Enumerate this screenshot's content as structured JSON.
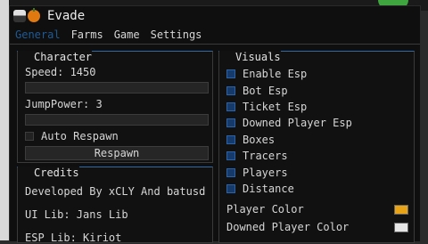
{
  "window": {
    "title": "Evade"
  },
  "menu": {
    "tabs": [
      "General",
      "Farms",
      "Game",
      "Settings"
    ],
    "active": "General"
  },
  "character": {
    "title": "Character",
    "speed_label": "Speed: 1450",
    "speed_value": 1450,
    "jump_label": "JumpPower: 3",
    "jump_value": 3,
    "auto_respawn_label": "Auto Respawn",
    "respawn_button": "Respawn"
  },
  "credits": {
    "title": "Credits",
    "lines": [
      "Developed By xCLY And batusd",
      "UI Lib: Jans Lib",
      "ESP Lib: Kiriot"
    ]
  },
  "visuals": {
    "title": "Visuals",
    "items": [
      "Enable Esp",
      "Bot Esp",
      "Ticket Esp",
      "Downed Player Esp",
      "Boxes",
      "Tracers",
      "Players",
      "Distance"
    ],
    "player_color_label": "Player Color",
    "player_color": "#e8a317",
    "downed_color_label": "Downed Player Color",
    "downed_color": "#e6e6e6"
  }
}
